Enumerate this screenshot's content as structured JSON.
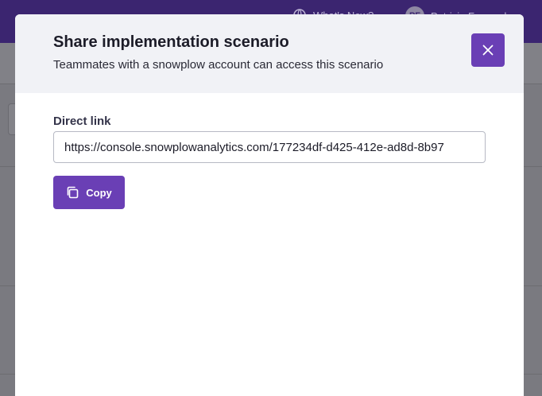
{
  "background": {
    "whats_new_label": "What's New?",
    "user_initials": "PF",
    "user_name": "Patricia Fernandez"
  },
  "modal": {
    "title": "Share implementation scenario",
    "subtitle": "Teammates with a snowplow account can access this scenario",
    "close_icon": "close-icon",
    "direct_link_label": "Direct link",
    "direct_link_value": "https://console.snowplowanalytics.com/177234df-d425-412e-ad8d-8b97",
    "copy_label": "Copy",
    "copy_icon": "copy-icon"
  },
  "colors": {
    "accent": "#6a3fb5",
    "header_bg": "#f1f2f6",
    "topbar": "#3b2570"
  }
}
